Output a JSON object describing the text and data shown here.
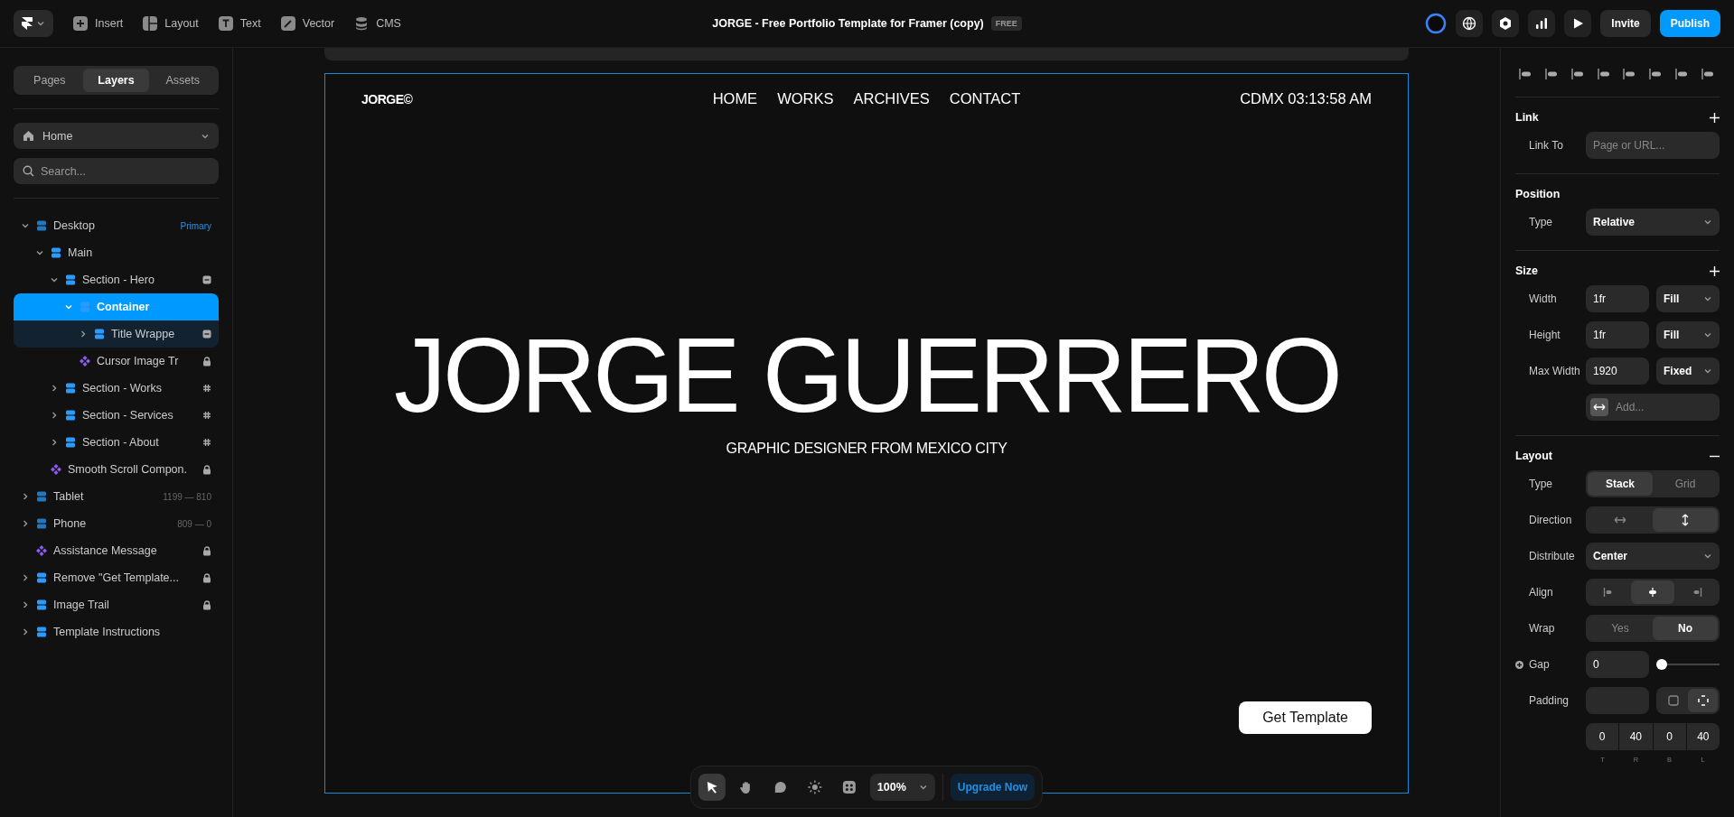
{
  "topbar": {
    "menu": [
      {
        "label": "Insert",
        "kind": "plus"
      },
      {
        "label": "Layout",
        "kind": "layout"
      },
      {
        "label": "Text",
        "kind": "text"
      },
      {
        "label": "Vector",
        "kind": "vector"
      },
      {
        "label": "CMS",
        "kind": "cms"
      }
    ],
    "title": "JORGE - Free Portfolio Template for Framer (copy)",
    "plan_badge": "FREE",
    "invite": "Invite",
    "publish": "Publish"
  },
  "left_panel": {
    "tabs": [
      {
        "label": "Pages",
        "selected": false
      },
      {
        "label": "Layers",
        "selected": true
      },
      {
        "label": "Assets",
        "selected": false
      }
    ],
    "page_select": "Home",
    "search_placeholder": "Search...",
    "layers": [
      {
        "name": "Desktop",
        "kind": "breakpoint",
        "expanded": true,
        "badge": "Primary",
        "selected": false,
        "children": [
          {
            "name": "Main",
            "kind": "frame",
            "expanded": true,
            "selected": false,
            "children": [
              {
                "name": "Section - Hero",
                "kind": "frame",
                "expanded": true,
                "marker": {
                  "kind": "stack"
                },
                "selected": false,
                "children": [
                  {
                    "name": "Container",
                    "kind": "frame",
                    "expanded": true,
                    "selected": true,
                    "children": [
                      {
                        "name": "Title Wrappe",
                        "kind": "frame",
                        "expanded": false,
                        "marker": {
                          "kind": "stack"
                        },
                        "selected": false
                      }
                    ]
                  },
                  {
                    "name": "Cursor Image Tr",
                    "kind": "component",
                    "marker": {
                      "kind": "lock"
                    },
                    "selected": false
                  }
                ]
              },
              {
                "name": "Section - Works",
                "kind": "frame",
                "expanded": false,
                "marker": {
                  "kind": "hash"
                },
                "selected": false
              },
              {
                "name": "Section - Services",
                "kind": "frame",
                "expanded": false,
                "marker": {
                  "kind": "hash"
                },
                "selected": false
              },
              {
                "name": "Section - About",
                "kind": "frame",
                "expanded": false,
                "marker": {
                  "kind": "hash"
                },
                "selected": false
              }
            ]
          },
          {
            "name": "Smooth Scroll Compon.",
            "kind": "component",
            "marker": {
              "kind": "lock"
            },
            "selected": false
          }
        ]
      },
      {
        "name": "Tablet",
        "kind": "breakpoint",
        "expanded": false,
        "badge": "1199 — 810",
        "selected": false
      },
      {
        "name": "Phone",
        "kind": "breakpoint",
        "expanded": false,
        "badge": "809 — 0",
        "selected": false
      },
      {
        "name": "Assistance Message",
        "kind": "component",
        "marker": {
          "kind": "lock"
        },
        "selected": false
      },
      {
        "name": "Remove \"Get Template...",
        "kind": "frame",
        "expanded": false,
        "marker": {
          "kind": "lock"
        },
        "selected": false
      },
      {
        "name": "Image Trail",
        "kind": "frame",
        "expanded": false,
        "marker": {
          "kind": "lock"
        },
        "selected": false
      },
      {
        "name": "Template Instructions",
        "kind": "frame",
        "expanded": false,
        "selected": false
      }
    ]
  },
  "site": {
    "logo": "JORGE©",
    "nav": [
      "HOME",
      "WORKS",
      "ARCHIVES",
      "CONTACT"
    ],
    "clock": "CDMX 03:13:58 AM",
    "hero_title": "JORGE GUERRERO",
    "subtitle": "GRAPHIC DESIGNER FROM MEXICO CITY",
    "cta": "Get Template"
  },
  "toolbar": {
    "tools": [
      {
        "kind": "pointer",
        "selected": true
      },
      {
        "kind": "hand",
        "selected": false
      },
      {
        "kind": "comment",
        "selected": false
      },
      {
        "kind": "sun",
        "selected": false
      },
      {
        "kind": "grid",
        "selected": false
      }
    ],
    "zoom": "100%",
    "upgrade": "Upgrade Now"
  },
  "right_panel": {
    "link": {
      "title": "Link",
      "label": "Link To",
      "placeholder": "Page or URL..."
    },
    "position": {
      "title": "Position",
      "label": "Type",
      "value": "Relative"
    },
    "size": {
      "title": "Size",
      "rows": [
        {
          "label": "Width",
          "value": "1fr",
          "mode": "Fill"
        },
        {
          "label": "Height",
          "value": "1fr",
          "mode": "Fill"
        },
        {
          "label": "Max Width",
          "value": "1920",
          "mode": "Fixed"
        }
      ],
      "add_placeholder": "Add..."
    },
    "layout": {
      "title": "Layout",
      "type": {
        "label": "Type",
        "options": [
          {
            "label": "Stack",
            "selected": true
          },
          {
            "label": "Grid",
            "selected": false
          }
        ]
      },
      "direction": {
        "label": "Direction",
        "options": [
          {
            "kind": "horizontal",
            "selected": false
          },
          {
            "kind": "vertical",
            "selected": true
          }
        ]
      },
      "distribute": {
        "label": "Distribute",
        "value": "Center"
      },
      "align": {
        "label": "Align",
        "options": [
          {
            "kind": "start",
            "selected": false
          },
          {
            "kind": "center",
            "selected": true
          },
          {
            "kind": "end",
            "selected": false
          }
        ]
      },
      "wrap": {
        "label": "Wrap",
        "options": [
          {
            "label": "Yes",
            "selected": false
          },
          {
            "label": "No",
            "selected": true
          }
        ]
      },
      "gap": {
        "label": "Gap",
        "value": "0",
        "level": 0
      },
      "padding": {
        "label": "Padding",
        "modes": [
          {
            "kind": "uniform",
            "selected": false
          },
          {
            "kind": "individual",
            "selected": true
          }
        ],
        "sides": [
          {
            "value": "0",
            "caption": "T"
          },
          {
            "value": "40",
            "caption": "R"
          },
          {
            "value": "0",
            "caption": "B"
          },
          {
            "value": "40",
            "caption": "L"
          }
        ]
      }
    }
  }
}
